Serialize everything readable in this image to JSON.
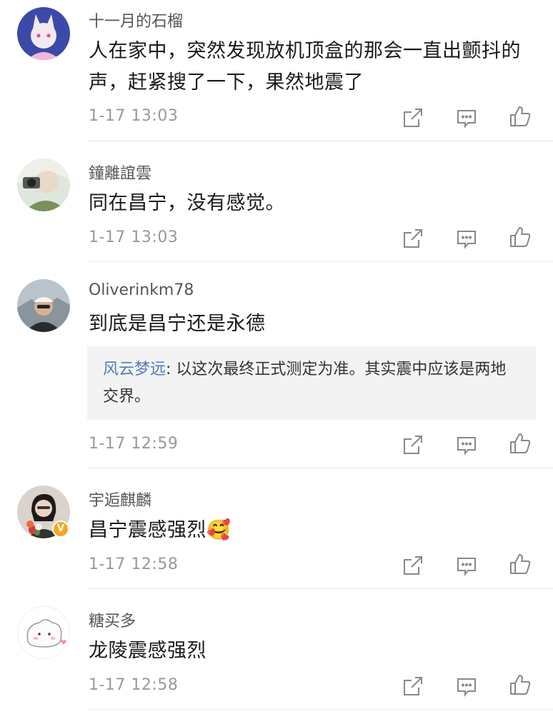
{
  "comments": [
    {
      "username": "十一月的石榴",
      "text": "人在家中，突然发现放机顶盒的那会一直出颤抖的声，赶紧搜了一下，果然地震了",
      "time": "1-17 13:03",
      "avatar": "anime-character"
    },
    {
      "username": "鐘離誼雲",
      "text": "同在昌宁，没有感觉。",
      "time": "1-17 13:03",
      "avatar": "camera-photo"
    },
    {
      "username": "Oliverinkm78",
      "text": "到底是昌宁还是永德",
      "reply": {
        "name": "风云梦远",
        "text": ": 以这次最终正式测定为准。其实震中应该是两地交界。"
      },
      "time": "1-17 12:59",
      "avatar": "man-with-cap"
    },
    {
      "username": "宇逅麒麟",
      "text": "昌宁震感强烈🥰",
      "time": "1-17 12:58",
      "avatar": "woman-with-flowers",
      "verified_badge": "V"
    },
    {
      "username": "糖买多",
      "text": "龙陵震感强烈",
      "time": "1-17 12:58",
      "avatar": "cute-blob"
    }
  ],
  "icons": {
    "share": "share-icon",
    "comment": "comment-icon",
    "like": "thumbs-up-icon"
  }
}
